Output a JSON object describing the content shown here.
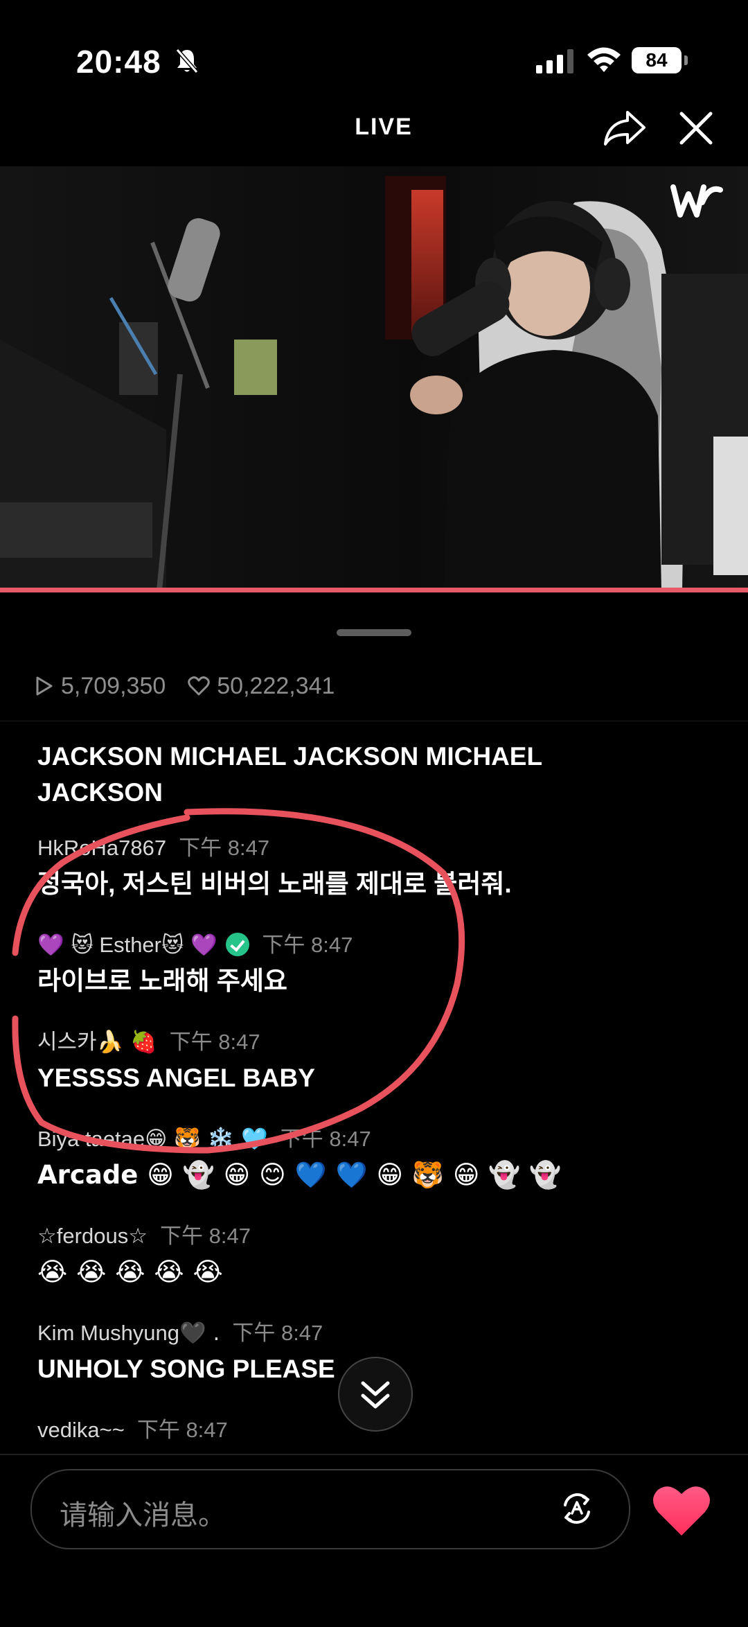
{
  "status_bar": {
    "time": "20:48",
    "battery": "84"
  },
  "header": {
    "title": "LIVE"
  },
  "stats": {
    "views": "5,709,350",
    "likes": "50,222,341"
  },
  "chat": {
    "partial_top": "JACKSON MICHAEL JACKSON MICHAEL JACKSON",
    "messages": [
      {
        "user": "HkRoHa7867",
        "time": "下午 8:47",
        "text": "정국아, 저스틴 비버의 노래를 제대로 불러줘."
      },
      {
        "user_pre": "💜 😻",
        "user": "Esther",
        "user_post": "😻 💜",
        "time": "下午 8:47",
        "text": "라이브로 노래해 주세요"
      },
      {
        "user": "시스카",
        "user_post": "🍌 🍓",
        "time": "下午 8:47",
        "text": "YESSSS ANGEL BABY"
      },
      {
        "user": "Biya taetae",
        "user_post": "😁 🐯 ❄️ 🩵",
        "time": "下午 8:47",
        "text": "Arcade 😁 👻 😁 😊 💙 💙 😁 🐯 😁 👻 👻"
      },
      {
        "user": "☆ferdous☆",
        "time": "下午 8:47",
        "text": "😭 😭 😭 😭 😭"
      },
      {
        "user": "Kim Mushyung",
        "user_post": "🖤 .",
        "time": "下午 8:47",
        "text": "UNHOLY SONG PLEASE"
      },
      {
        "user": "vedika~~",
        "time": "下午 8:47",
        "text": ""
      }
    ]
  },
  "input": {
    "placeholder": "请输入消息。"
  },
  "colors": {
    "accent_red": "#e65a68",
    "heart": "#ff3b6b",
    "verified": "#27c48a",
    "annotation": "#e8525c"
  }
}
